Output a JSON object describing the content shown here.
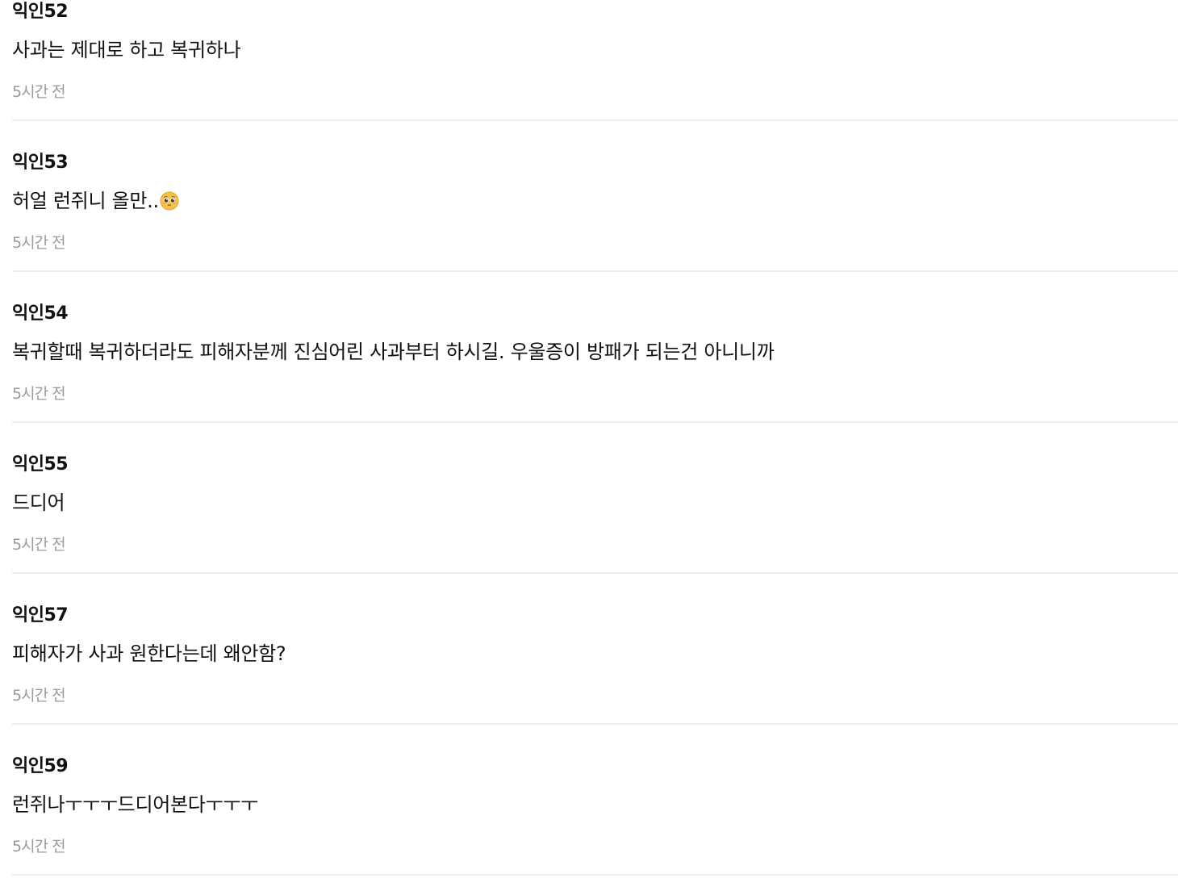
{
  "comments": [
    {
      "author": "익인52",
      "text": "사과는 제대로 하고 복귀하나",
      "time": "5시간 전"
    },
    {
      "author": "익인53",
      "text": "허얼 런쥐니 올만..",
      "emoji": "pleading-face-icon",
      "time": "5시간 전"
    },
    {
      "author": "익인54",
      "text": "복귀할때 복귀하더라도 피해자분께 진심어린 사과부터 하시길. 우울증이 방패가 되는건 아니니까",
      "time": "5시간 전"
    },
    {
      "author": "익인55",
      "text": "드디어",
      "time": "5시간 전"
    },
    {
      "author": "익인57",
      "text": "피해자가 사과 원한다는데 왜안함?",
      "time": "5시간 전"
    },
    {
      "author": "익인59",
      "text": "런쥐나ㅜㅜㅜ드디어본다ㅜㅜㅜ",
      "time": "5시간 전"
    }
  ],
  "colors": {
    "text": "#111111",
    "time": "#9a9a9a",
    "divider": "#ececec",
    "emoji_face": "#f7c24a"
  }
}
